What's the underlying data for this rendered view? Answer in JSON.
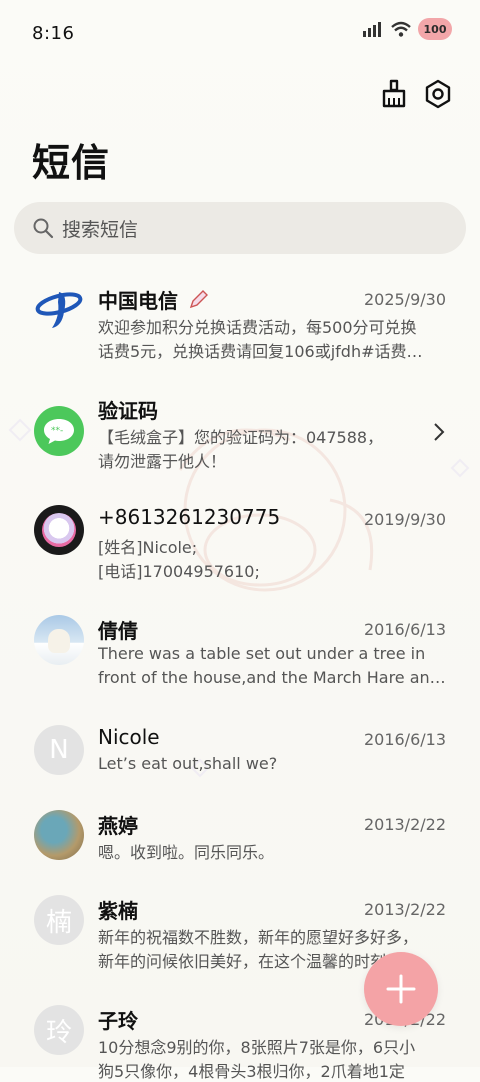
{
  "status_bar": {
    "time": "8:16",
    "battery": "100"
  },
  "header": {
    "title": "短信",
    "icons": [
      "broom-icon",
      "settings-icon"
    ]
  },
  "search": {
    "placeholder": "搜索短信"
  },
  "messages": [
    {
      "name": "中国电信",
      "date": "2025/9/30",
      "line1": "欢迎参加积分兑换话费活动，每500分可兑换",
      "line2": "话费5元，兑换话费请回复106或jfdh#话费…",
      "avatar": "telecom-logo",
      "tag_icon": "pencil-icon"
    },
    {
      "name": "验证码",
      "date": "",
      "line1": "【毛绒盒子】您的验证码为：047588，",
      "line2": "请勿泄露于他人！",
      "avatar": "message-icon",
      "chevron": "chevron-right-icon"
    },
    {
      "name": "+8613261230775",
      "date": "2019/9/30",
      "line1": "[姓名]Nicole;",
      "line2": "[电话]17004957610;",
      "avatar": "photo"
    },
    {
      "name": "倩倩",
      "date": "2016/6/13",
      "line1": "There was a table set out under a tree in",
      "line2": "front of the house,and the March Hare an…",
      "avatar": "polar-bear-photo"
    },
    {
      "name": "Nicole",
      "date": "2016/6/13",
      "line1": "Let’s eat out,shall we?",
      "line2": "",
      "avatar_letter": "N"
    },
    {
      "name": "燕婷",
      "date": "2013/2/22",
      "line1": "嗯。收到啦。同乐同乐。",
      "line2": "",
      "avatar": "landscape-photo"
    },
    {
      "name": "紫楠",
      "date": "2013/2/22",
      "line1": "新年的祝福数不胜数，新年的愿望好多好多，",
      "line2": "新年的问候依旧美好，在这个温馨的时刻",
      "avatar_letter": "楠"
    },
    {
      "name": "子玲",
      "date": "2013/2/22",
      "line1": "10分想念9别的你，8张照片7张是你，6只小",
      "line2": "狗5只像你，4根骨头3根归你，2爪着地1定",
      "avatar_letter": "玲"
    }
  ],
  "fab": {
    "icon": "plus-icon"
  },
  "colors": {
    "accent": "#f4a3a6",
    "background": "#f9f8f3",
    "search_bg": "#eceae5"
  }
}
